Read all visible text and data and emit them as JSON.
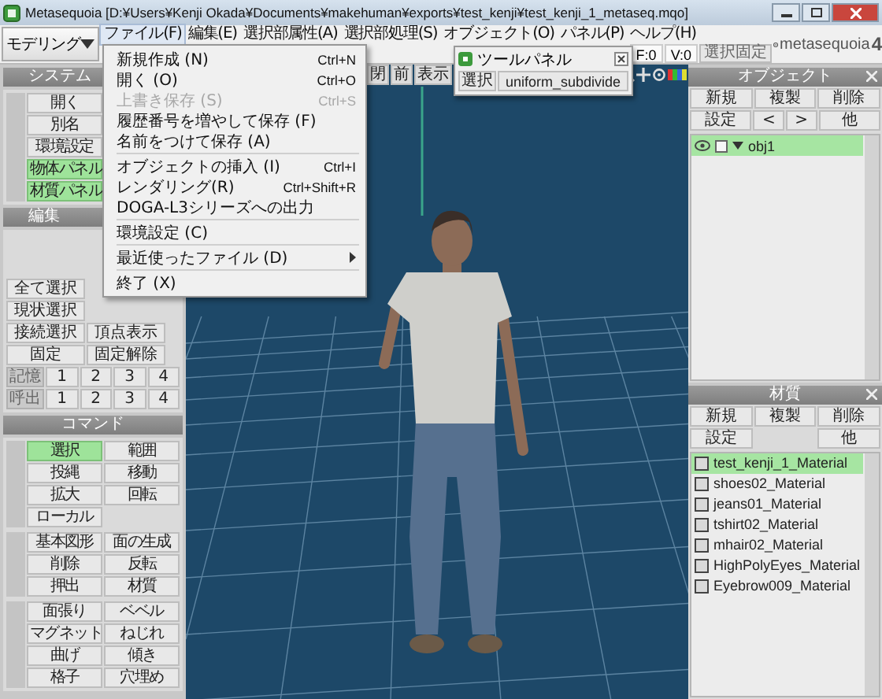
{
  "window": {
    "title": "Metasequoia [D:¥Users¥Kenji Okada¥Documents¥makehuman¥exports¥test_kenji¥test_kenji_1_metaseq.mqo]"
  },
  "mode": {
    "label": "モデリング"
  },
  "menu": [
    {
      "label": "ファイル(F)",
      "selected": true
    },
    {
      "label": "編集(E)",
      "selected": false
    },
    {
      "label": "選択部属性(A)",
      "selected": false
    },
    {
      "label": "選択部処理(S)",
      "selected": false
    },
    {
      "label": "オブジェクト(O)",
      "selected": false
    },
    {
      "label": "パネル(P)",
      "selected": false
    },
    {
      "label": "ヘルプ(H)",
      "selected": false
    }
  ],
  "status": {
    "faces": "F:0",
    "vertices": "V:0",
    "fix_button": "選択固定"
  },
  "logo": {
    "name": "metasequoia",
    "version": "4"
  },
  "file_menu": [
    {
      "kind": "item",
      "label": "新規作成 (N)",
      "shortcut": "Ctrl+N",
      "disabled": false
    },
    {
      "kind": "item",
      "label": "開く (O)",
      "shortcut": "Ctrl+O",
      "disabled": false
    },
    {
      "kind": "item",
      "label": "上書き保存 (S)",
      "shortcut": "Ctrl+S",
      "disabled": true
    },
    {
      "kind": "item",
      "label": "履歴番号を増やして保存 (F)",
      "disabled": false
    },
    {
      "kind": "item",
      "label": "名前をつけて保存 (A)",
      "disabled": false
    },
    {
      "kind": "separator"
    },
    {
      "kind": "item",
      "label": "オブジェクトの挿入 (I)",
      "shortcut": "Ctrl+I",
      "disabled": false
    },
    {
      "kind": "item",
      "label": "レンダリング(R)",
      "shortcut": "Ctrl+Shift+R",
      "disabled": false
    },
    {
      "kind": "item",
      "label": "DOGA-L3シリーズへの出力",
      "disabled": false
    },
    {
      "kind": "separator"
    },
    {
      "kind": "item",
      "label": "環境設定 (C)",
      "disabled": false
    },
    {
      "kind": "separator"
    },
    {
      "kind": "submenu",
      "label": "最近使ったファイル (D)",
      "disabled": false
    },
    {
      "kind": "separator"
    },
    {
      "kind": "item",
      "label": "終了 (X)",
      "disabled": false
    }
  ],
  "system_panel": {
    "title": "システム",
    "buttons": [
      {
        "label": "開く",
        "on": false
      },
      {
        "label": "別名",
        "on": false
      },
      {
        "label": "環境設定",
        "on": false
      },
      {
        "label": "物体パネル",
        "on": true
      },
      {
        "label": "材質パネル",
        "on": true
      }
    ]
  },
  "edit_panel": {
    "title": "編集",
    "rows": [
      [
        "全て選択"
      ],
      [
        "現状選択"
      ],
      [
        "接続選択",
        "頂点表示"
      ],
      [
        "固定",
        "固定解除"
      ]
    ],
    "memory": {
      "label": "記憶",
      "slots": [
        "1",
        "2",
        "3",
        "4"
      ]
    },
    "recall": {
      "label": "呼出",
      "slots": [
        "1",
        "2",
        "3",
        "4"
      ]
    }
  },
  "command_panel": {
    "title": "コマンド",
    "groups": [
      {
        "buttons": [
          {
            "label": "選択",
            "selected": true
          },
          {
            "label": "範囲",
            "selected": false
          },
          {
            "label": "投縄",
            "selected": false
          },
          {
            "label": "移動",
            "selected": false
          },
          {
            "label": "拡大",
            "selected": false
          },
          {
            "label": "回転",
            "selected": false
          },
          {
            "label": "ローカル",
            "selected": false
          }
        ]
      },
      {
        "buttons": [
          {
            "label": "基本図形",
            "selected": false
          },
          {
            "label": "面の生成",
            "selected": false
          },
          {
            "label": "削除",
            "selected": false
          },
          {
            "label": "反転",
            "selected": false
          },
          {
            "label": "押出",
            "selected": false
          },
          {
            "label": "材質",
            "selected": false
          }
        ]
      },
      {
        "buttons": [
          {
            "label": "面張り",
            "selected": false
          },
          {
            "label": "ベベル",
            "selected": false
          },
          {
            "label": "マグネット",
            "selected": false
          },
          {
            "label": "ねじれ",
            "selected": false
          },
          {
            "label": "曲げ",
            "selected": false
          },
          {
            "label": "傾き",
            "selected": false
          },
          {
            "label": "格子",
            "selected": false
          },
          {
            "label": "穴埋め",
            "selected": false
          }
        ]
      }
    ]
  },
  "viewport": {
    "buttons": [
      "閉",
      "前",
      "表示"
    ]
  },
  "tool_panel": {
    "title": "ツールパネル",
    "buttons": [
      "選択",
      "uniform_subdivide"
    ]
  },
  "object_panel": {
    "title": "オブジェクト",
    "actions": [
      "新規",
      "複製",
      "削除"
    ],
    "controls": [
      "設定",
      "<",
      ">",
      "他"
    ],
    "objects": [
      {
        "name": "obj1",
        "visible": true,
        "locked": false,
        "expanded": true,
        "selected": true
      }
    ]
  },
  "material_panel": {
    "title": "材質",
    "actions": [
      "新規",
      "複製",
      "削除"
    ],
    "settings_button": "設定",
    "other_button": "他",
    "materials": [
      {
        "name": "test_kenji_1_Material",
        "selected": true
      },
      {
        "name": "shoes02_Material",
        "selected": false
      },
      {
        "name": "jeans01_Material",
        "selected": false
      },
      {
        "name": "tshirt02_Material",
        "selected": false
      },
      {
        "name": "mhair02_Material",
        "selected": false
      },
      {
        "name": "HighPolyEyes_Material",
        "selected": false
      },
      {
        "name": "Eyebrow009_Material",
        "selected": false
      }
    ]
  }
}
